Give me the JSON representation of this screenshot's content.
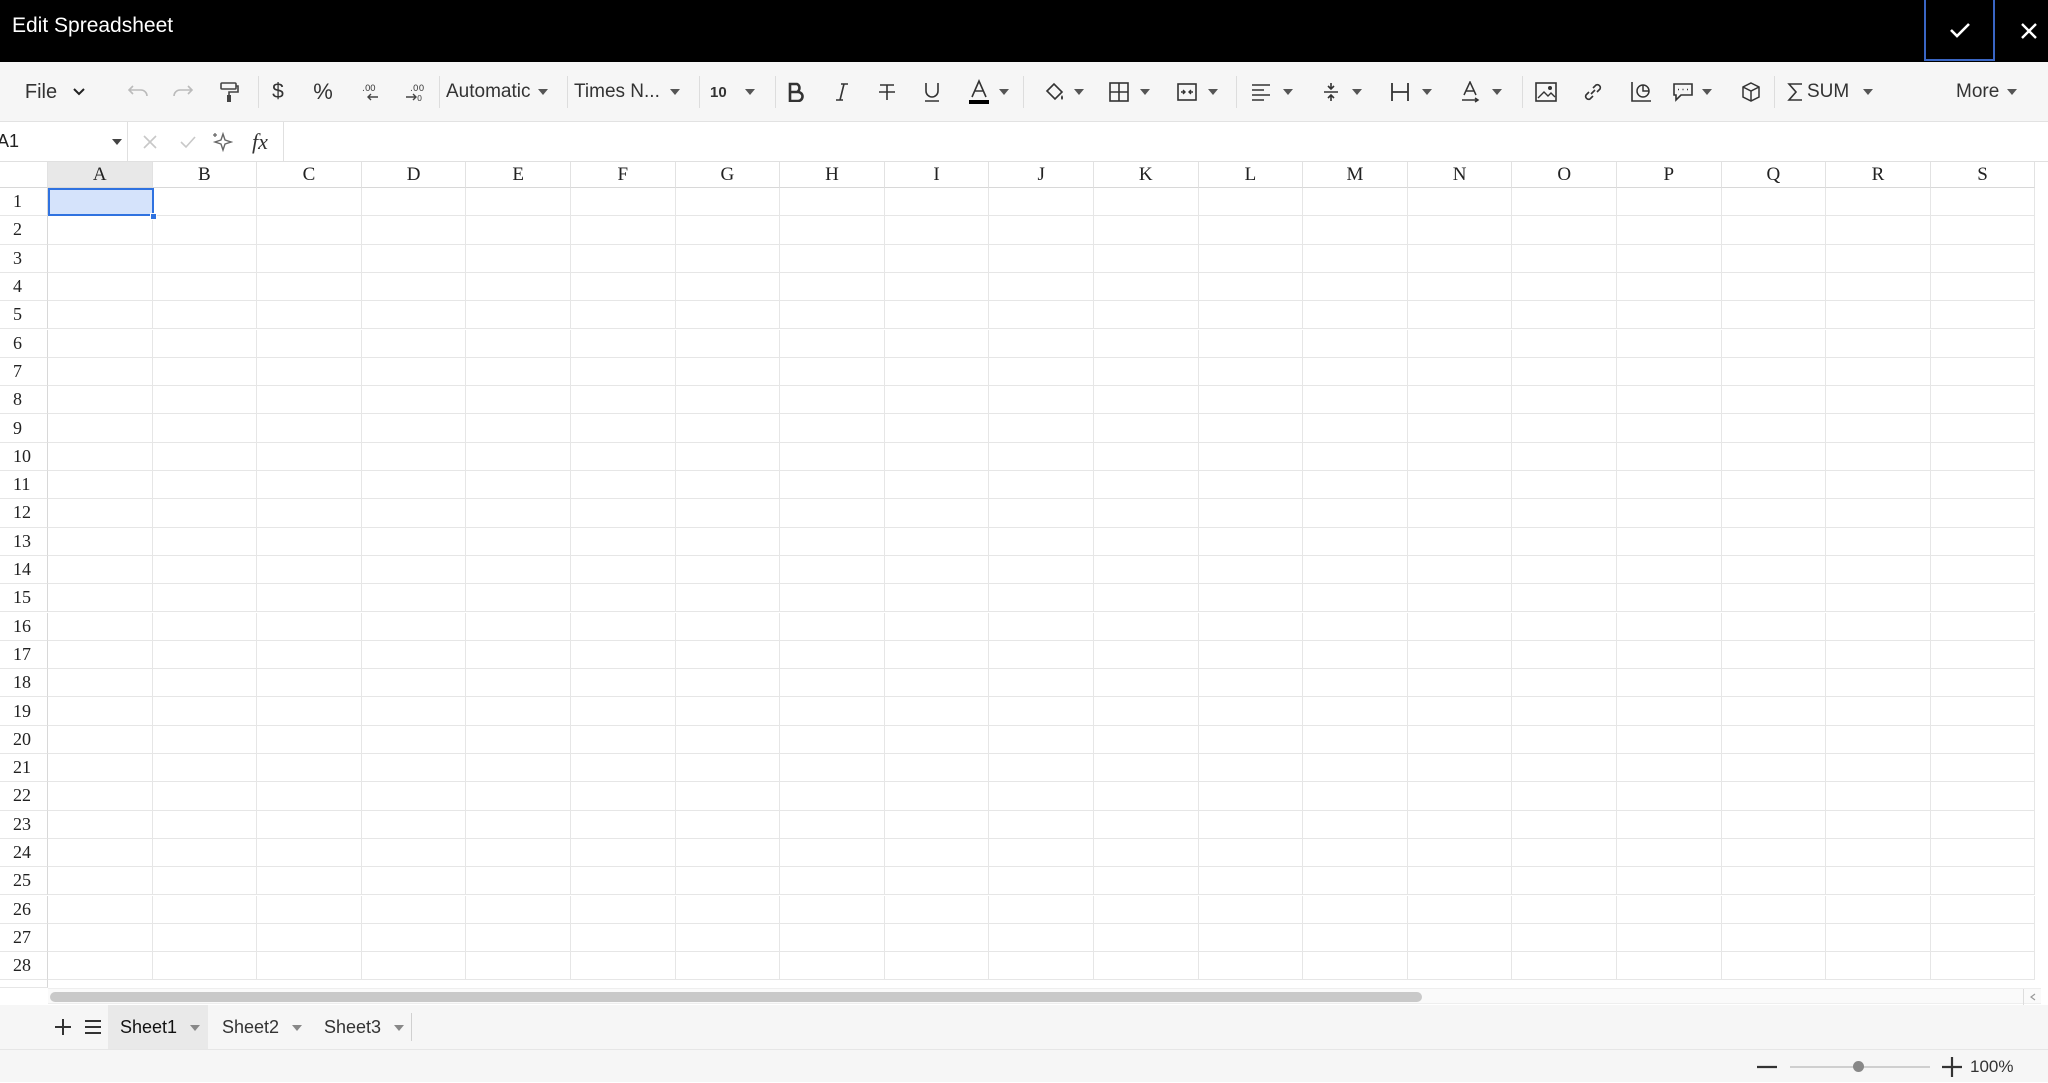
{
  "titlebar": {
    "title": "Edit Spreadsheet"
  },
  "toolbar": {
    "file_label": "File",
    "format_label": "Automatic",
    "font_label": "Times N...",
    "size_label": "10",
    "currency_label": "$",
    "percent_label": "%",
    "sum_label": "SUM",
    "more_label": "More"
  },
  "formula_bar": {
    "cell_ref": "A1",
    "fx_label": "fx",
    "formula_value": ""
  },
  "grid": {
    "columns": [
      "A",
      "B",
      "C",
      "D",
      "E",
      "F",
      "G",
      "H",
      "I",
      "J",
      "K",
      "L",
      "M",
      "N",
      "O",
      "P",
      "Q",
      "R",
      "S"
    ],
    "rows": [
      "1",
      "2",
      "3",
      "4",
      "5",
      "6",
      "7",
      "8",
      "9",
      "10",
      "11",
      "12",
      "13",
      "14",
      "15",
      "16",
      "17",
      "18",
      "19",
      "20",
      "21",
      "22",
      "23",
      "24",
      "25",
      "26",
      "27",
      "28"
    ],
    "selected_cell": "A1"
  },
  "sheets": {
    "tabs": [
      "Sheet1",
      "Sheet2",
      "Sheet3"
    ],
    "active": "Sheet1"
  },
  "status": {
    "zoom": "100%"
  },
  "colors": {
    "titlebar_bg": "#000000",
    "selection_fill": "#d5e3fb",
    "selection_border": "#2f72e0",
    "confirm_border": "#3a66c4"
  }
}
